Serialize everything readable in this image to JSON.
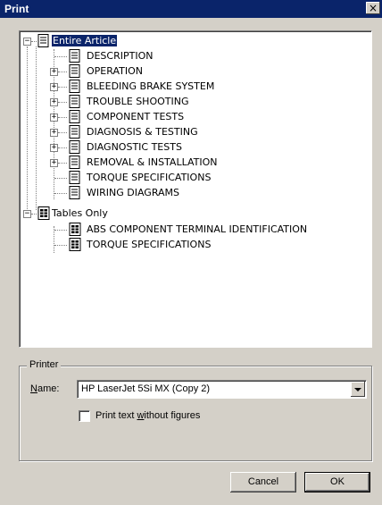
{
  "window": {
    "title": "Print",
    "close_glyph": "×"
  },
  "tree": {
    "root": {
      "label": "Entire Article",
      "expander": "−"
    },
    "article_items": [
      {
        "label": "DESCRIPTION",
        "expander": ""
      },
      {
        "label": "OPERATION",
        "expander": "+"
      },
      {
        "label": "BLEEDING BRAKE SYSTEM",
        "expander": "+"
      },
      {
        "label": "TROUBLE SHOOTING",
        "expander": "+"
      },
      {
        "label": "COMPONENT TESTS",
        "expander": "+"
      },
      {
        "label": "DIAGNOSIS & TESTING",
        "expander": "+"
      },
      {
        "label": "DIAGNOSTIC TESTS",
        "expander": "+"
      },
      {
        "label": "REMOVAL & INSTALLATION",
        "expander": "+"
      },
      {
        "label": "TORQUE SPECIFICATIONS",
        "expander": ""
      },
      {
        "label": "WIRING DIAGRAMS",
        "expander": ""
      }
    ],
    "tables_root": {
      "label": "Tables Only",
      "expander": "−"
    },
    "table_items": [
      {
        "label": "ABS COMPONENT TERMINAL IDENTIFICATION"
      },
      {
        "label": "TORQUE SPECIFICATIONS"
      }
    ]
  },
  "printer": {
    "group_label": "Printer",
    "name_label_prefix": "",
    "name_label_access": "N",
    "name_label_rest": "ame:",
    "selected_printer": "HP LaserJet 5Si MX (Copy 2)",
    "checkbox_label_pre": "Print text ",
    "checkbox_label_access": "w",
    "checkbox_label_post": "ithout figures",
    "checkbox_checked": false
  },
  "buttons": {
    "cancel": "Cancel",
    "ok": "OK"
  }
}
